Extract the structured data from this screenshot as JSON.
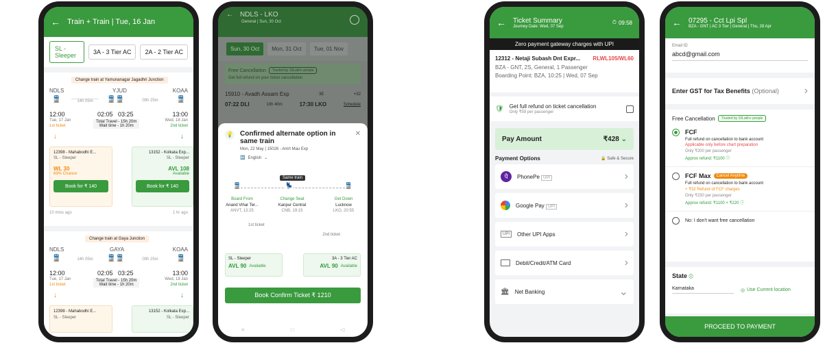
{
  "p1": {
    "title": "Train + Train  |  Tue, 16 Jan",
    "classes": [
      "SL - Sleeper",
      "3A - 3 Tier AC",
      "2A - 2 Tier AC"
    ],
    "opt1": {
      "change": "Change train at Yamunanagar Jagadhri Junction",
      "from": "NDLS",
      "via": "YJUD",
      "to": "KOAA",
      "d1": "14h 05m",
      "d2": "09h 25m",
      "t1": "12:00",
      "t2": "02:05",
      "t3": "03:25",
      "t4": "13:00",
      "date1": "Tue, 17 Jan",
      "date2": "Wed, 18 Jan",
      "tk1": "1st ticket",
      "tk2": "2nd ticket",
      "travel": "Total Travel - 15h 20m",
      "wait": "Wait time - 1h 20m",
      "tr1": "12398 - Mahabodhi E...",
      "cls1": "SL - Sleeper",
      "st1": "WL 30",
      "ch1": "69% Chance",
      "book1": "Book for ₹ 140",
      "tr2": "13152 - Kolkata Exp...",
      "cls2": "SL - Sleeper",
      "st2": "AVL 108",
      "ch2": "Available",
      "book2": "Book for ₹ 140",
      "ago1": "10 mins ago",
      "ago2": "1 hr ago"
    },
    "opt2": {
      "change": "Change train at Gaya Junction",
      "from": "NDLS",
      "via": "GAYA",
      "to": "KOAA",
      "d1": "14h 05m",
      "d2": "09h 25m",
      "t1": "12:00",
      "t2": "02:05",
      "t3": "03:25",
      "t4": "13:00",
      "date1": "Tue, 17 Jan",
      "date2": "Wed, 18 Jan",
      "tk1": "1st ticket",
      "tk2": "2nd ticket",
      "travel": "Total Travel - 15h 20m",
      "wait": "Wait time - 1h 20m",
      "tr1": "12398 - Mahabodhi E...",
      "cls1": "SL - Sleeper",
      "tr2": "13152 - Kolkata Exp...",
      "cls2": "SL - Sleeper"
    }
  },
  "p2": {
    "route": "NDLS - LKO",
    "sub": "General | Sun, 30 Oct",
    "dates": [
      "Sun, 30 Oct",
      "Mon, 31 Oct",
      "Tue, 01 Nov"
    ],
    "fc": "Free Cancellation",
    "trusted": "Trusted by 10Lakh+ people",
    "refund": "Get full refund on your ticket cancellation",
    "train": "15910 - Avadh Assam Exp",
    "dep": "07:22 DLI",
    "dur": "10h 40m",
    "arr": "17:30 LKO",
    "sched": "Schedule",
    "cls": "3E",
    "wl": "+32",
    "sheet": {
      "title": "Confirmed alternate option in same train",
      "meta": "Mon, 22 May  |  15026 - Amrt Mau Exp",
      "lang": "English",
      "same": "Same train",
      "lbls": [
        "Board From",
        "Change Seat",
        "Get Down"
      ],
      "stns": [
        "Anand Vihar Ter...",
        "Kanpur Central",
        "Lucknow"
      ],
      "codes": [
        "ANVT, 13:25",
        "CNB, 19:15",
        "LKO, 20:55"
      ],
      "tk1": "1st ticket",
      "tk2": "2nd ticket",
      "c1": "SL - Sleeper",
      "a1": "AVL 90",
      "v1": "Available",
      "c2": "3A - 3 Tier AC",
      "a2": "AVL 90",
      "v2": "Available",
      "cta": "Book Confirm Ticket ₹ 1210"
    }
  },
  "p3": {
    "title": "Ticket Summary",
    "sub": "Journey Date: Wed, 07 Sep",
    "timer": "09:58",
    "banner": "Zero payment gateway charges with UPI",
    "train": "12312 - Netaji Subash Dnt Expr...",
    "wl": "RLWL105/WL60",
    "info": "BZA - GNT,  2S,  General,  1 Passenger",
    "board": "Boarding Point: BZA, 10:25  |  Wed, 07 Sep",
    "refund": "Get full refund on ticket cancellation",
    "refsub": "Only ₹59 per passenger",
    "pay": "Pay Amount",
    "amt": "₹428",
    "opts": "Payment Options",
    "safe": "Safe & Secure",
    "methods": [
      "PhonePe",
      "Google Pay",
      "Other UPI Apps",
      "Debit/Credit/ATM Card",
      "Net Banking"
    ],
    "upi": "UPI"
  },
  "p4": {
    "title": "07295 - Cct Lpi Spl",
    "sub": "BZA - GNT  |  AC 3 Tier  |  General  |  Thu, 28 Apr",
    "emailLbl": "Email ID",
    "email": "abcd@gmail.com",
    "gst": "Enter GST for Tax Benefits",
    "gstOpt": "(Optional)",
    "fc": "Free Cancellation",
    "trusted": "Trusted by 10Lakh+ people",
    "fcf": {
      "name": "FCF",
      "l1": "Full refund on cancellation to bank account",
      "l2": "Applicable only before chart preparation",
      "l3": "Only ₹200 per passenger",
      "l4": "Approx refund: ₹1100"
    },
    "max": {
      "name": "FCF Max",
      "tag": "Cancel Anytime",
      "l1": "Full refund on cancellation to bank account",
      "l2": "+ ₹32 Refund of FCF charges",
      "l3": "Only ₹230 per passenger",
      "l4": "Approx refund: ₹1100 + ₹220"
    },
    "no": "No: I don't want free cancellation",
    "state": "State",
    "stateVal": "Karnataka",
    "loc": "Use Current location",
    "cta": "PROCEED TO PAYMENT"
  }
}
